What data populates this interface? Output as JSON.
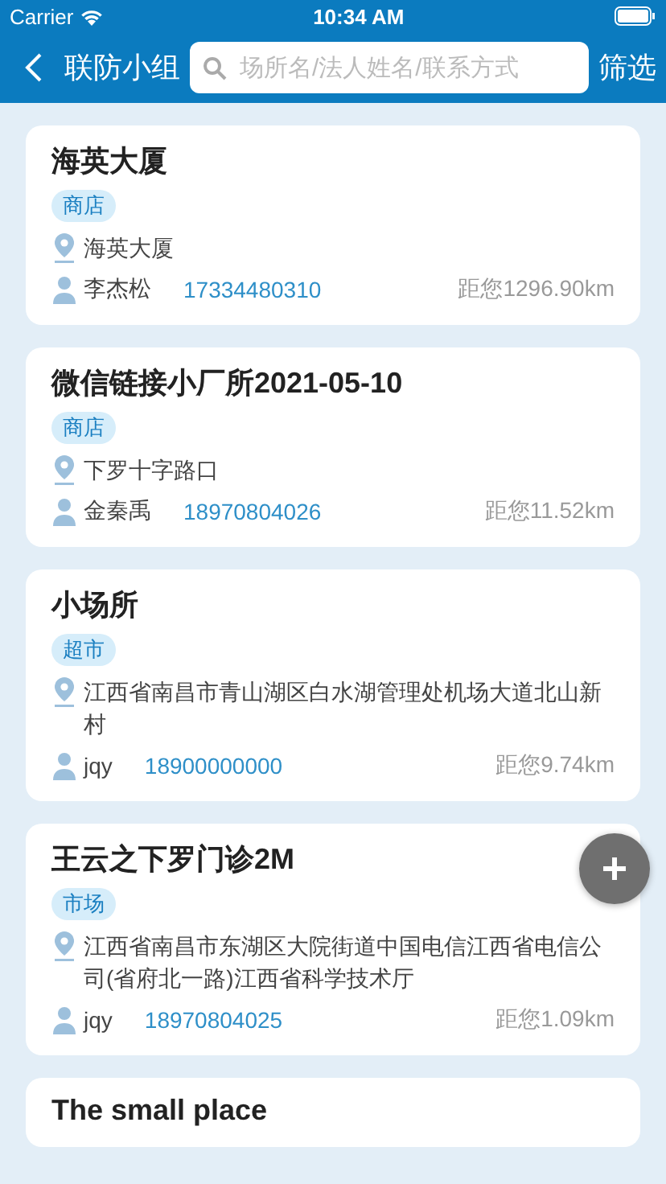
{
  "status_bar": {
    "carrier": "Carrier",
    "time": "10:34 AM"
  },
  "nav": {
    "title": "联防小组",
    "search": {
      "placeholder": "场所名/法人姓名/联系方式"
    },
    "filter": "筛选"
  },
  "places": [
    {
      "name": "海英大厦",
      "tag": "商店",
      "address": "海英大厦",
      "person": "李杰松",
      "phone": "17334480310",
      "distance": "距您1296.90km"
    },
    {
      "name": "微信链接小厂所2021-05-10",
      "tag": "商店",
      "address": "下罗十字路口",
      "person": "金秦禹",
      "phone": "18970804026",
      "distance": "距您11.52km"
    },
    {
      "name": "小场所",
      "tag": "超市",
      "address": "江西省南昌市青山湖区白水湖管理处机场大道北山新村",
      "person": "jqy",
      "phone": "18900000000",
      "distance": "距您9.74km"
    },
    {
      "name": "王云之下罗门诊2M",
      "tag": "市场",
      "address": "江西省南昌市东湖区大院街道中国电信江西省电信公司(省府北一路)江西省科学技术厅",
      "person": "jqy",
      "phone": "18970804025",
      "distance": "距您1.09km"
    },
    {
      "name": "The small place"
    }
  ]
}
